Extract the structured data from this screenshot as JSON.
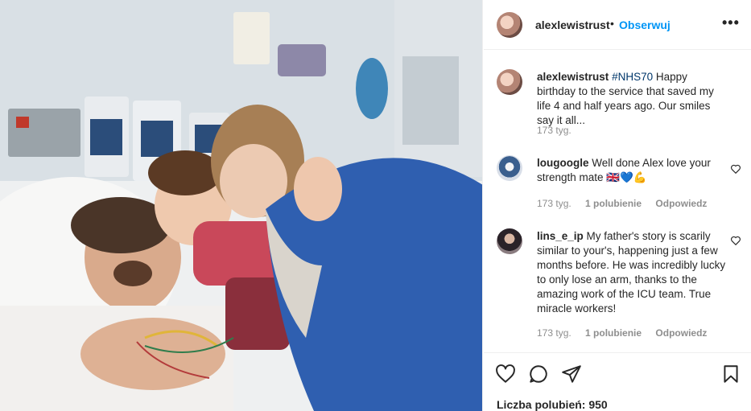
{
  "post": {
    "username": "alexlewistrust",
    "separator": "•",
    "follow_label": "Obserwuj",
    "more_label": "•••",
    "photo_alt": "Post photo"
  },
  "caption": {
    "username": "alexlewistrust",
    "hashtag": "#NHS70",
    "text": "Happy birthday to the service that saved my life 4 and half years ago. Our smiles say it all...",
    "time": "173 tyg."
  },
  "comments": [
    {
      "username": "lougoogle",
      "text": "Well done Alex love your strength mate 🇬🇧💙💪",
      "time": "173 tyg.",
      "likes": "1 polubienie",
      "reply": "Odpowiedz"
    },
    {
      "username": "lins_e_ip",
      "text": "My father's story is scarily similar to your's, happening just a few months before. He was incredibly lucky to only lose an arm, thanks to the amazing work of the ICU team. True miracle workers!",
      "time": "173 tyg.",
      "likes": "1 polubienie",
      "reply": "Odpowiedz"
    }
  ],
  "likes_text": "Liczba polubień: 950",
  "icons": {
    "like": "heart-icon",
    "comment": "comment-icon",
    "share": "share-icon",
    "save": "bookmark-icon",
    "more": "more-icon",
    "comment_like": "heart-icon"
  }
}
